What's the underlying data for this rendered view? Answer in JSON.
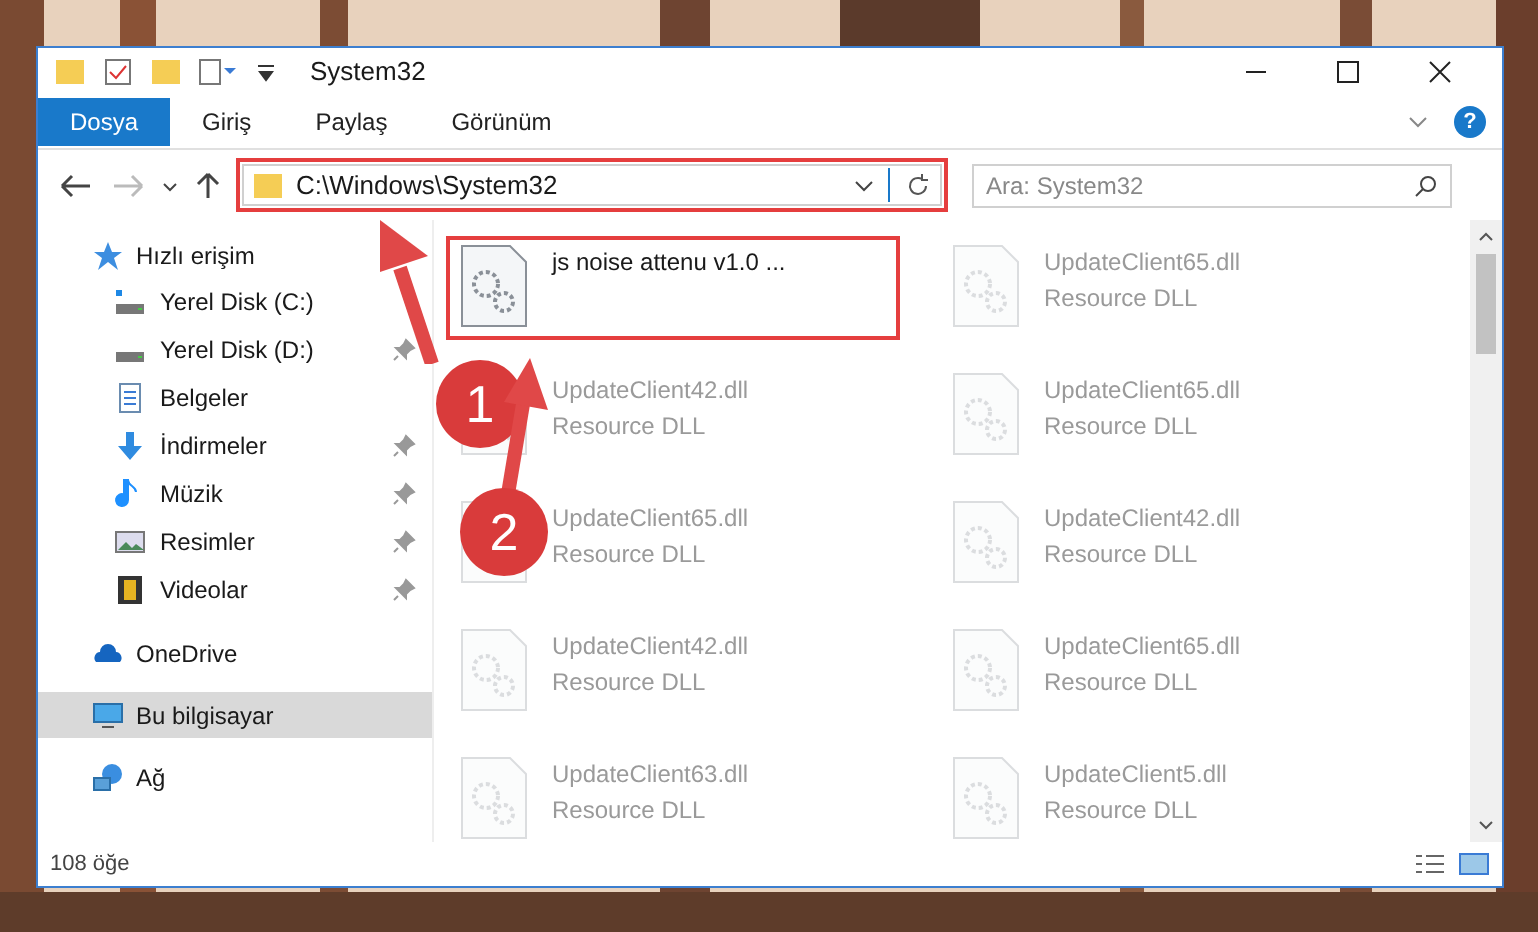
{
  "window": {
    "title": "System32"
  },
  "ribbon_tabs": [
    {
      "label": "Dosya",
      "selected": true
    },
    {
      "label": "Giriş",
      "selected": false
    },
    {
      "label": "Paylaş",
      "selected": false
    },
    {
      "label": "Görünüm",
      "selected": false
    }
  ],
  "help": "?",
  "address": {
    "value": "C:\\Windows\\System32",
    "highlighted": true
  },
  "search": {
    "placeholder": "Ara: System32"
  },
  "sidebar": {
    "items": [
      {
        "label": "Hızlı erişim",
        "selected": false,
        "children": [
          {
            "label": "Yerel Disk (C:)",
            "pinned": false
          },
          {
            "label": "Yerel Disk (D:)",
            "pinned": true
          },
          {
            "label": "Belgeler",
            "pinned": false
          },
          {
            "label": "İndirmeler",
            "pinned": true
          },
          {
            "label": "Müzik",
            "pinned": true
          },
          {
            "label": "Resimler",
            "pinned": true
          },
          {
            "label": "Videolar",
            "pinned": true
          }
        ]
      },
      {
        "label": "OneDrive",
        "selected": false
      },
      {
        "label": "Bu bilgisayar",
        "selected": true
      },
      {
        "label": "Ağ",
        "selected": false
      }
    ]
  },
  "files": [
    {
      "name": "js noise attenu v1.0 ...",
      "blurred": false,
      "highlighted": true
    },
    {
      "name": "UpdateClient65.dll",
      "type": "Resource DLL",
      "blurred": true,
      "highlighted": false
    },
    {
      "name": "UpdateClient42.dll",
      "type": "Resource DLL",
      "blurred": true,
      "highlighted": false
    },
    {
      "name": "UpdateClient65.dll",
      "type": "Resource DLL",
      "blurred": true,
      "highlighted": false
    },
    {
      "name": "UpdateClient65.dll",
      "type": "Resource DLL",
      "blurred": true,
      "highlighted": false
    },
    {
      "name": "UpdateClient42.dll",
      "type": "Resource DLL",
      "blurred": true,
      "highlighted": false
    },
    {
      "name": "UpdateClient42.dll",
      "type": "Resource DLL",
      "blurred": true,
      "highlighted": false
    },
    {
      "name": "UpdateClient65.dll",
      "type": "Resource DLL",
      "blurred": true,
      "highlighted": false
    },
    {
      "name": "UpdateClient63.dll",
      "type": "Resource DLL",
      "blurred": true,
      "highlighted": false
    },
    {
      "name": "UpdateClient5.dll",
      "type": "Resource DLL",
      "blurred": true,
      "highlighted": false
    }
  ],
  "status_bar": {
    "count": "108 öğe"
  },
  "annotations": [
    {
      "number": "1"
    },
    {
      "number": "2"
    }
  ]
}
